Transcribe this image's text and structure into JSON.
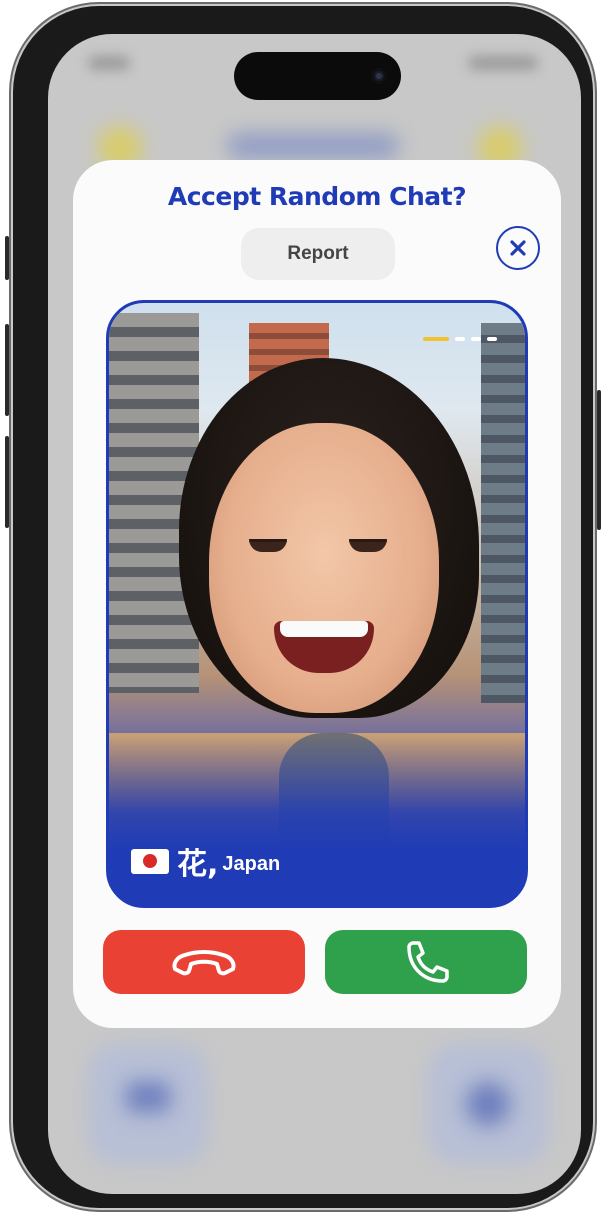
{
  "modal": {
    "title": "Accept Random Chat?",
    "report_label": "Report",
    "close_icon": "close-circle-icon"
  },
  "profile": {
    "name": "花",
    "country": "Japan",
    "flag": "japan-flag-icon",
    "photo_progress": {
      "total": 4,
      "current": 1
    }
  },
  "actions": {
    "decline_icon": "hang-up-icon",
    "accept_icon": "phone-icon"
  },
  "colors": {
    "accent_blue": "#1f3bb6",
    "decline_red": "#e94134",
    "accept_green": "#2fa14d",
    "progress_active": "#f0c232"
  }
}
